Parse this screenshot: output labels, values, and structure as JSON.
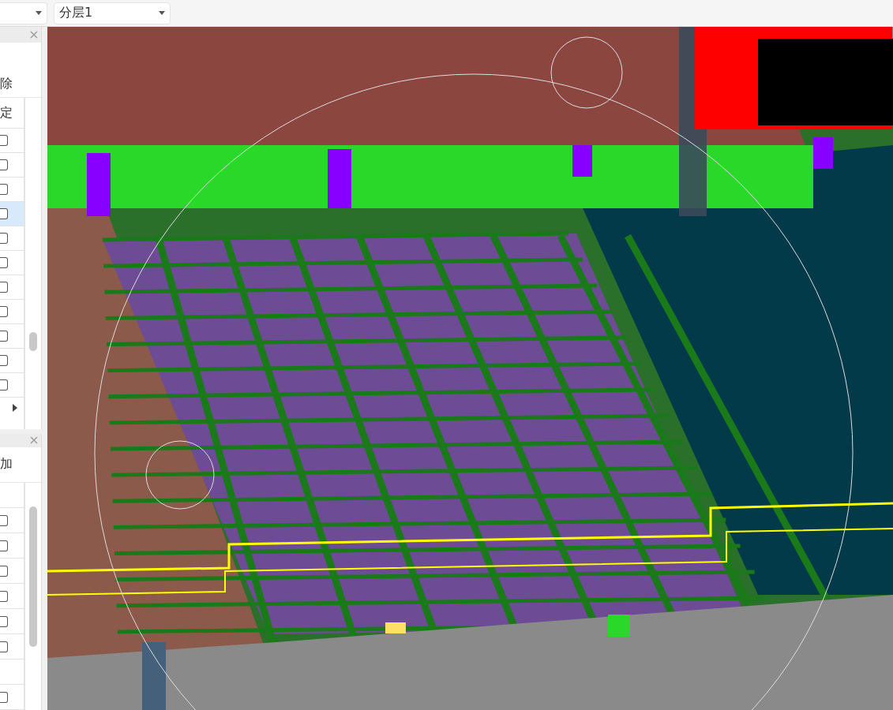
{
  "toolbar": {
    "layer_dropdown": {
      "value": "分层1"
    }
  },
  "panels": [
    {
      "action": "除",
      "column_header": "定",
      "rows": [
        {
          "kind": "checkbox",
          "checked": false,
          "selected": false
        },
        {
          "kind": "checkbox",
          "checked": false,
          "selected": false
        },
        {
          "kind": "checkbox",
          "checked": false,
          "selected": false
        },
        {
          "kind": "checkbox",
          "checked": false,
          "selected": true
        },
        {
          "kind": "checkbox",
          "checked": false,
          "selected": false
        },
        {
          "kind": "checkbox",
          "checked": false,
          "selected": false
        },
        {
          "kind": "checkbox",
          "checked": false,
          "selected": false
        },
        {
          "kind": "checkbox",
          "checked": false,
          "selected": false
        },
        {
          "kind": "checkbox",
          "checked": false,
          "selected": false
        },
        {
          "kind": "checkbox",
          "checked": false,
          "selected": false
        },
        {
          "kind": "checkbox",
          "checked": false,
          "selected": false
        }
      ]
    },
    {
      "action": "加",
      "rows": [
        {
          "kind": "empty",
          "selected": false
        },
        {
          "kind": "checkbox",
          "checked": false,
          "selected": false
        },
        {
          "kind": "checkbox",
          "checked": false,
          "selected": false
        },
        {
          "kind": "checkbox",
          "checked": false,
          "selected": false
        },
        {
          "kind": "checkbox",
          "checked": false,
          "selected": false
        },
        {
          "kind": "checkbox",
          "checked": false,
          "selected": false
        },
        {
          "kind": "checkbox",
          "checked": false,
          "selected": false
        },
        {
          "kind": "empty",
          "selected": false
        },
        {
          "kind": "checkbox",
          "checked": false,
          "selected": false
        }
      ]
    }
  ]
}
